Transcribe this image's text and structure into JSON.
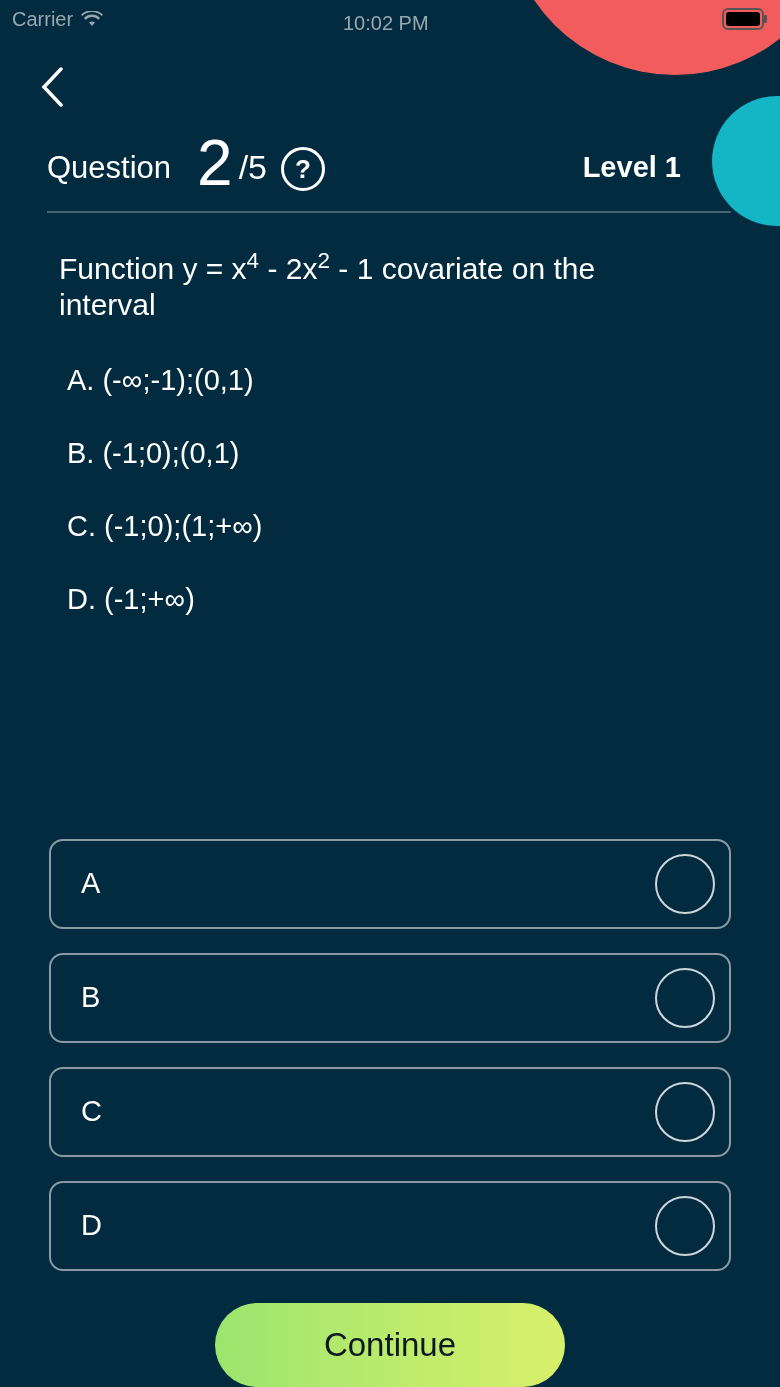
{
  "status_bar": {
    "carrier": "Carrier",
    "time": "10:02 PM"
  },
  "header": {
    "label": "Question",
    "current": "2",
    "total": "/5",
    "help": "?",
    "level": "Level 1"
  },
  "question": "Function y = x$^{4}$ - 2x$^{2}$ - 1 covariate on the interval",
  "options": [
    "A. (-∞;-1);(0,1)",
    "B. (-1;0);(0,1)",
    "C. (-1;0);(1;+∞)",
    "D. (-1;+∞)"
  ],
  "answers": [
    {
      "label": "A",
      "selected": false
    },
    {
      "label": "B",
      "selected": false
    },
    {
      "label": "C",
      "selected": false
    },
    {
      "label": "D",
      "selected": false
    }
  ],
  "continue_button": "Continue"
}
